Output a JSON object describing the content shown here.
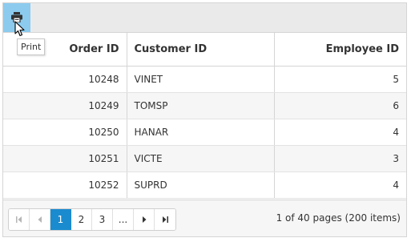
{
  "toolbar": {
    "print_tooltip": "Print",
    "print_icon": "printer-icon"
  },
  "columns": [
    {
      "label": "Order ID"
    },
    {
      "label": "Customer ID"
    },
    {
      "label": "Employee ID"
    }
  ],
  "rows": [
    {
      "order_id": "10248",
      "customer_id": "VINET",
      "employee_id": "5"
    },
    {
      "order_id": "10249",
      "customer_id": "TOMSP",
      "employee_id": "6"
    },
    {
      "order_id": "10250",
      "customer_id": "HANAR",
      "employee_id": "4"
    },
    {
      "order_id": "10251",
      "customer_id": "VICTE",
      "employee_id": "3"
    },
    {
      "order_id": "10252",
      "customer_id": "SUPRD",
      "employee_id": "4"
    }
  ],
  "pager": {
    "first_icon": "first-page-icon",
    "prev_icon": "previous-page-icon",
    "pages": [
      "1",
      "2",
      "3"
    ],
    "more": "...",
    "next_icon": "next-page-icon",
    "last_icon": "last-page-icon",
    "current_page": "1",
    "info": "1 of 40 pages (200 items)"
  },
  "colors": {
    "accent": "#1a8bcf",
    "print_button_bg": "#8ccbee",
    "toolbar_bg": "#eaeaea"
  }
}
